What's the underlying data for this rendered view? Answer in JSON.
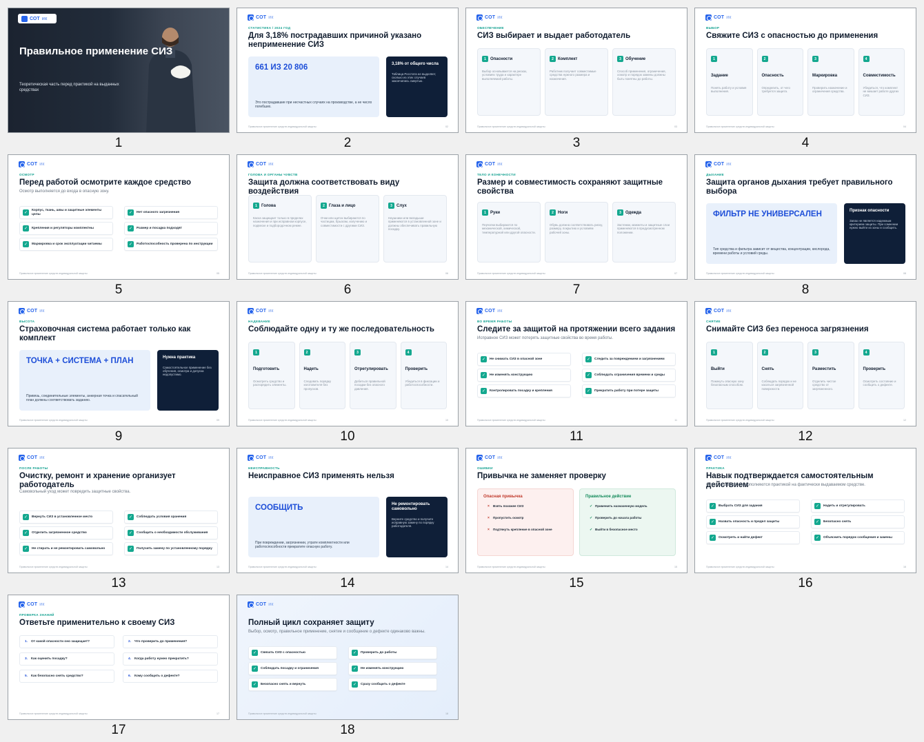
{
  "logo": {
    "main": "СОТ",
    "suffix": "ик"
  },
  "footer": "Правильное применение средств индивидуальной защиты",
  "slides": [
    {
      "n": "1",
      "title": "Правильное применение СИЗ",
      "subtitle": "Теоретическая часть перед практикой на выданных средствах"
    },
    {
      "n": "2",
      "page": "02",
      "kicker": "СТАТИСТИКА / 2024 ГОД",
      "title": "Для 3,18% пострадавших причиной указано неприменение СИЗ",
      "big": "661 ИЗ 20 806",
      "big_desc": "Это пострадавшие при несчастных случаях на производстве, а не число погибших.",
      "dark_head": "3,18% от общего числа",
      "dark_desc": "Таблица Росстата не выделяет, сколько из этих случаев закончились смертью."
    },
    {
      "n": "3",
      "page": "03",
      "kicker": "ОБЕСПЕЧЕНИЕ",
      "title": "СИЗ выбирает и выдает работодатель",
      "cards": [
        {
          "b": "1",
          "h": "Опасности",
          "d": "Выбор основывается на рисках, условиях труда и характере выполняемой работы."
        },
        {
          "b": "2",
          "h": "Комплект",
          "d": "Работник получает совместимые средства нужного размера и назначения."
        },
        {
          "b": "3",
          "h": "Обучение",
          "d": "Способ применения, ограничения, осмотр и порядок замены должны быть понятны до работы."
        }
      ]
    },
    {
      "n": "4",
      "page": "04",
      "kicker": "ВЫБОР",
      "title": "Свяжите СИЗ с опасностью до применения",
      "cards": [
        {
          "b": "1",
          "h": "Задание",
          "d": "Понять работу и условия выполнения."
        },
        {
          "b": "2",
          "h": "Опасность",
          "d": "Определить, от чего требуется защита."
        },
        {
          "b": "3",
          "h": "Маркировка",
          "d": "Проверить назначение и ограничения средства."
        },
        {
          "b": "4",
          "h": "Совместимость",
          "d": "Убедиться, что комплект не мешает работе других СИЗ."
        }
      ]
    },
    {
      "n": "5",
      "page": "05",
      "kicker": "ОСМОТР",
      "title": "Перед работой осмотрите каждое средство",
      "subtitle": "Осмотр выполняется до входа в опасную зону.",
      "checks": [
        "Корпус, ткань, швы и защитные элементы целы",
        "Нет опасного загрязнения",
        "Крепления и регуляторы комплектны",
        "Размер и посадка подходят",
        "Маркировка и срок эксплуатации читаемы",
        "Работоспособность проверена по инструкции"
      ]
    },
    {
      "n": "6",
      "page": "06",
      "kicker": "ГОЛОВА И ОРГАНЫ ЧУВСТВ",
      "title": "Защита должна соответствовать виду воздействия",
      "cards": [
        {
          "b": "1",
          "h": "Голова",
          "d": "Каска защищает только в пределах назначения и при исправном корпусе, подвеске и подбородочном ремне."
        },
        {
          "b": "2",
          "h": "Глаза и лицо",
          "d": "Очки или щиток выбираются по частицам, брызгам, излучению и совместимости с другими СИЗ."
        },
        {
          "b": "3",
          "h": "Слух",
          "d": "Наушники или вкладыши применяются в установленной зоне и должны обеспечивать правильную посадку."
        }
      ]
    },
    {
      "n": "7",
      "page": "07",
      "kicker": "ТЕЛО И КОНЕЧНОСТИ",
      "title": "Размер и совместимость сохраняют защитные свойства",
      "cards": [
        {
          "b": "1",
          "h": "Руки",
          "d": "Перчатки выбираются по механической, химической, температурной или другой опасности."
        },
        {
          "b": "2",
          "h": "Ноги",
          "d": "Обувь должна соответствовать риску, размеру, покрытию и условиям рабочей зоны."
        },
        {
          "b": "3",
          "h": "Одежда",
          "d": "Застежки, манжеты и защитные слои применяются в предусмотренном положении."
        }
      ]
    },
    {
      "n": "8",
      "page": "08",
      "kicker": "ДЫХАНИЕ",
      "title": "Защита органов дыхания требует правильного выбора",
      "big": "ФИЛЬТР НЕ УНИВЕРСАЛЕН",
      "big_desc": "Тип средства и фильтра зависит от вещества, концентрации, кислорода, времени работы и условий среды.",
      "dark_head": "Признак опасности",
      "dark_desc": "Запах не является надежным критерием защиты. При сомнении нужно выйти из зоны и сообщить."
    },
    {
      "n": "9",
      "page": "09",
      "kicker": "ВЫСОТА",
      "title": "Страховочная система работает только как комплект",
      "big": "ТОЧКА + СИСТЕМА + ПЛАН",
      "big_desc": "Привязь, соединительные элементы, анкерная точка и спасательный план должны соответствовать заданию.",
      "dark_head": "Нужна практика",
      "dark_desc": "Самостоятельное применение без обучения, осмотра и допуска недопустимо."
    },
    {
      "n": "10",
      "page": "10",
      "kicker": "НАДЕВАНИЕ",
      "title": "Соблюдайте одну и ту же последовательность",
      "cards": [
        {
          "b": "1",
          "h": "Подготовить",
          "d": "Осмотреть средство и распорядить элементы."
        },
        {
          "b": "2",
          "h": "Надеть",
          "d": "Следовать порядку изготовителя без пропусков."
        },
        {
          "b": "3",
          "h": "Отрегулировать",
          "d": "Добиться правильной посадки без опасного давления."
        },
        {
          "b": "4",
          "h": "Проверить",
          "d": "Убедиться в фиксации и работоспособности."
        }
      ]
    },
    {
      "n": "11",
      "page": "11",
      "kicker": "ВО ВРЕМЯ РАБОТЫ",
      "title": "Следите за защитой на протяжении всего задания",
      "subtitle": "Исправное СИЗ может потерять защитные свойства во время работы.",
      "checks": [
        "Не снимать СИЗ в опасной зоне",
        "Следить за повреждением и загрязнением",
        "Не изменять конструкцию",
        "Соблюдать ограничения времени и среды",
        "Контролировать посадку и крепления",
        "Прекратить работу при потере защиты"
      ]
    },
    {
      "n": "12",
      "page": "12",
      "kicker": "СНЯТИЕ",
      "title": "Снимайте СИЗ без переноса загрязнения",
      "cards": [
        {
          "b": "1",
          "h": "Выйти",
          "d": "Покинуть опасную зону безопасным способом."
        },
        {
          "b": "2",
          "h": "Снять",
          "d": "Соблюдать порядок и не касаться загрязненной поверхности."
        },
        {
          "b": "3",
          "h": "Разместить",
          "d": "Отделить чистое средство от загрязненного."
        },
        {
          "b": "4",
          "h": "Проверить",
          "d": "Осмотреть состояние и сообщить о дефекте."
        }
      ]
    },
    {
      "n": "13",
      "page": "13",
      "kicker": "ПОСЛЕ РАБОТЫ",
      "title": "Очистку, ремонт и хранение организует работодатель",
      "subtitle": "Самовольный уход может повредить защитные свойства.",
      "checks": [
        "Вернуть СИЗ в установленное место",
        "Соблюдать условия хранения",
        "Отделить загрязненное средство",
        "Сообщить о необходимости обслуживания",
        "Не стирать и не ремонтировать самовольно",
        "Получить замену по установленному порядку"
      ]
    },
    {
      "n": "14",
      "page": "14",
      "kicker": "НЕИСПРАВНОСТЬ",
      "title": "Неисправное СИЗ применять нельзя",
      "big": "СООБЩИТЬ",
      "big_desc": "При повреждении, загрязнении, утрате комплектности или работоспособности прекратите опасную работу.",
      "dark_head": "Не ремонтировать самовольно",
      "dark_desc": "Верните средство и получите исправную замену по порядку работодателя."
    },
    {
      "n": "15",
      "page": "15",
      "kicker": "ОШИБКИ",
      "title": "Привычка не заменяет проверку",
      "left_head": "Опасная привычка",
      "left": [
        "Взять похожее СИЗ",
        "Пропустить осмотр",
        "Подтянуть крепление в опасной зоне"
      ],
      "right_head": "Правильное действие",
      "right": [
        "Применить назначенную модель",
        "Проверить до начала работы",
        "Выйти в безопасное место"
      ]
    },
    {
      "n": "16",
      "page": "16",
      "kicker": "ПРАКТИКА",
      "title": "Навык подтверждается самостоятельным действием",
      "subtitle": "Ответы на вопросы дополняются практикой на фактически выдаваемом средстве.",
      "checks": [
        "Выбрать СИЗ для задания",
        "Надеть и отрегулировать",
        "Назвать опасность и предел защиты",
        "Безопасно снять",
        "Осмотреть и найти дефект",
        "Объяснить порядок сообщения и замены"
      ]
    },
    {
      "n": "17",
      "page": "17",
      "kicker": "ПРОВЕРКА ЗНАНИЙ",
      "title": "Ответьте применительно к своему СИЗ",
      "questions": [
        {
          "n": "1.",
          "t": "От какой опасности оно защищает?"
        },
        {
          "n": "2.",
          "t": "Что проверить до применения?"
        },
        {
          "n": "3.",
          "t": "Как оценить посадку?"
        },
        {
          "n": "4.",
          "t": "Когда работу нужно прекратить?"
        },
        {
          "n": "5.",
          "t": "Как безопасно снять средство?"
        },
        {
          "n": "6.",
          "t": "Кому сообщить о дефекте?"
        }
      ]
    },
    {
      "n": "18",
      "page": "18",
      "title": "Полный цикл сохраняет защиту",
      "subtitle": "Выбор, осмотр, правильное применение, снятие и сообщение о дефекте одинаково важны.",
      "checks": [
        "Связать СИЗ с опасностью",
        "Проверить до работы",
        "Соблюдать посадку и ограничения",
        "Не изменять конструкцию",
        "Безопасно снять и вернуть",
        "Сразу сообщить о дефекте"
      ]
    }
  ]
}
